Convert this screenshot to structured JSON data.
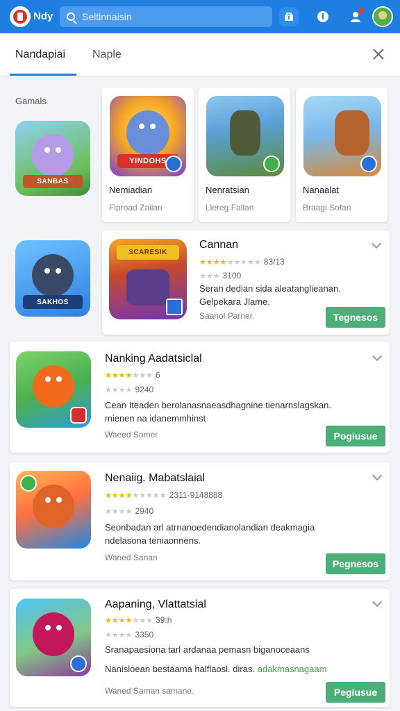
{
  "header": {
    "app_name": "Ndy",
    "search_placeholder": "Seltinnaisin",
    "icons": [
      "logo-icon",
      "search-icon",
      "store-icon",
      "info-icon",
      "user-icon",
      "avatar"
    ]
  },
  "tabs": [
    {
      "label": "Nandapiai",
      "active": true
    },
    {
      "label": "Naple",
      "active": false
    }
  ],
  "section": {
    "label": "Gamals"
  },
  "featured": [
    {
      "name": "Nemiadian",
      "sub": "Fiproad Zailan",
      "icon_text": "YINDOHS",
      "colors": [
        "#f6a623",
        "#7a3fd1"
      ],
      "badge_color": "#2b6fd6"
    },
    {
      "name": "Nenratsian",
      "sub": "Llereg Fallan",
      "icon_text": "",
      "colors": [
        "#5aa0d8",
        "#5c8a3c"
      ],
      "badge_color": "#43b047"
    },
    {
      "name": "Nanaalat",
      "sub": "Braagi Sofan",
      "icon_text": "",
      "colors": [
        "#7ab8ea",
        "#b5642d"
      ],
      "badge_color": "#2b6fd6"
    }
  ],
  "left_icons": [
    {
      "text": "SANBAS",
      "colors": [
        "#6bbf59",
        "#8c6fd6"
      ]
    },
    {
      "text": "SAKHOS",
      "colors": [
        "#3a8fe0",
        "#1d4fa5"
      ]
    }
  ],
  "apps": [
    {
      "title": "Cannan",
      "rating_stars": 4,
      "rating_text": "83/13",
      "sub_stars": 2,
      "sub_text": "3100",
      "desc": "Seran dedian sida aleatanglieanan. Gelpekara Jlame.",
      "footer": "Saanol Parner.",
      "button": "Tegnesos",
      "icon_text": "SCARESIK",
      "colors": [
        "#f5a524",
        "#7034b8"
      ],
      "badge_color": "#2b6fd6"
    },
    {
      "title": "Nanking Aadatsiclal",
      "rating_stars": 4,
      "rating_text": "6",
      "sub_stars": 3,
      "sub_text": "9240",
      "desc": "Cean Iteaden berolanasnaeasdhagnine tienarnslagskan. mienen na idanemmhinst",
      "footer": "Waeed Samer",
      "button": "Pogiusue",
      "icon_text": "",
      "colors": [
        "#4caf50",
        "#f26b1d"
      ],
      "badge_color": "#d32f2f"
    },
    {
      "title": "Nenaiig. Mabatslaial",
      "rating_stars": 4,
      "rating_text": "2311-9148888",
      "sub_stars": 3,
      "sub_text": "2940",
      "desc": "Seonbadan arl atrnanoedendianolandian deakmagia ndelasona teniaonnens.",
      "footer": "Waned Sanan",
      "button": "Pegnesos",
      "icon_text": "",
      "colors": [
        "#1e88e5",
        "#ff9800"
      ],
      "badge_color": "#43b047"
    },
    {
      "title": "Aapaning, Vlattatsial",
      "rating_stars": 4,
      "rating_text": "39:h",
      "sub_stars": 3,
      "sub_text": "3350",
      "desc": "Sranapaesiona tarl ardanaa pemasn biganoceaans",
      "desc2": "Nanisloean bestaama halflaosl. diras.",
      "desc2_link": "adakmasnagaam",
      "footer": "Waned Saman samane.",
      "button": "Pegiusue",
      "icon_text": "",
      "colors": [
        "#4fc3f7",
        "#8e3a9e"
      ],
      "badge_color": "#2b6fd6"
    }
  ]
}
